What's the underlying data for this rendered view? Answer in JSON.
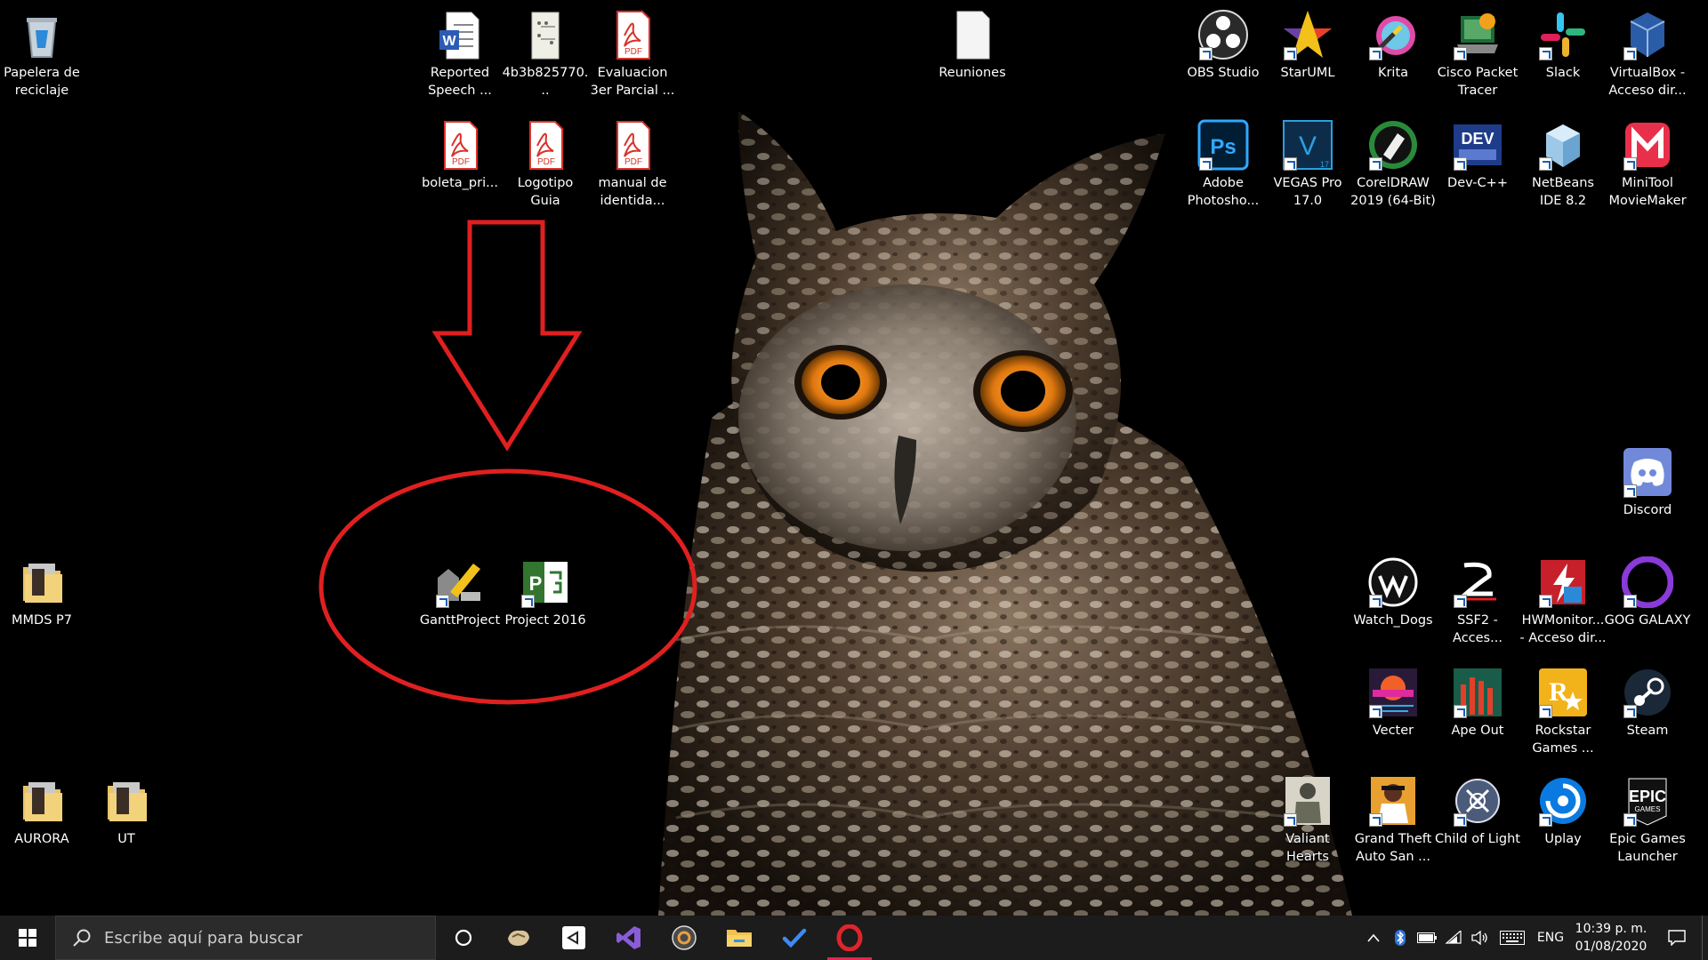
{
  "desktop": {
    "icons": [
      {
        "label": "Papelera de reciclaje",
        "icon": "recycle-bin"
      },
      {
        "label": "Reported Speech ...",
        "icon": "word-doc"
      },
      {
        "label": "4b3b825770...",
        "icon": "image-file"
      },
      {
        "label": "Evaluacion 3er Parcial ...",
        "icon": "pdf-file"
      },
      {
        "label": "Reuniones",
        "icon": "blank-file"
      },
      {
        "label": "OBS Studio",
        "icon": "obs"
      },
      {
        "label": "StarUML",
        "icon": "staruml"
      },
      {
        "label": "Krita",
        "icon": "krita"
      },
      {
        "label": "Cisco Packet Tracer",
        "icon": "cisco-packet-tracer"
      },
      {
        "label": "Slack",
        "icon": "slack"
      },
      {
        "label": "VirtualBox - Acceso dir...",
        "icon": "virtualbox"
      },
      {
        "label": "boleta_pri...",
        "icon": "pdf-file"
      },
      {
        "label": "Logotipo Guia",
        "icon": "pdf-file"
      },
      {
        "label": "manual de identida...",
        "icon": "pdf-file"
      },
      {
        "label": "Adobe Photosho...",
        "icon": "photoshop"
      },
      {
        "label": "VEGAS Pro 17.0",
        "icon": "vegas"
      },
      {
        "label": "CorelDRAW 2019 (64-Bit)",
        "icon": "coreldraw"
      },
      {
        "label": "Dev-C++",
        "icon": "devcpp"
      },
      {
        "label": "NetBeans IDE 8.2",
        "icon": "netbeans"
      },
      {
        "label": "MiniTool MovieMaker",
        "icon": "minitool"
      },
      {
        "label": "Discord",
        "icon": "discord"
      },
      {
        "label": "MMDS P7",
        "icon": "folder"
      },
      {
        "label": "GanttProject",
        "icon": "ganttproject"
      },
      {
        "label": "Project 2016",
        "icon": "ms-project"
      },
      {
        "label": "Watch_Dogs",
        "icon": "watch-dogs"
      },
      {
        "label": "SSF2 - Acces...",
        "icon": "ssf2"
      },
      {
        "label": "HWMonitor... - Acceso dir...",
        "icon": "hwmonitor"
      },
      {
        "label": "GOG GALAXY",
        "icon": "gog"
      },
      {
        "label": "Vecter",
        "icon": "vecter"
      },
      {
        "label": "Ape Out",
        "icon": "ape-out"
      },
      {
        "label": "Rockstar Games ...",
        "icon": "rockstar"
      },
      {
        "label": "Steam",
        "icon": "steam"
      },
      {
        "label": "AURORA",
        "icon": "folder"
      },
      {
        "label": "UT",
        "icon": "folder"
      },
      {
        "label": "Valiant Hearts",
        "icon": "valiant-hearts"
      },
      {
        "label": "Grand Theft Auto San ...",
        "icon": "gta-sa"
      },
      {
        "label": "Child of Light",
        "icon": "child-of-light"
      },
      {
        "label": "Uplay",
        "icon": "uplay"
      },
      {
        "label": "Epic Games Launcher",
        "icon": "epic-games"
      }
    ]
  },
  "taskbar": {
    "search_placeholder": "Escribe aquí para buscar",
    "pinned": [
      "start",
      "cortana",
      "app-1",
      "unity",
      "visual-studio",
      "obs",
      "file-explorer",
      "todo",
      "opera"
    ],
    "language": "ENG",
    "time": "10:39 p. m.",
    "date": "01/08/2020"
  },
  "colors": {
    "annotation": "#e02020",
    "taskbar_bg": "#1c1c1c",
    "opera_active": "#e0274d"
  }
}
